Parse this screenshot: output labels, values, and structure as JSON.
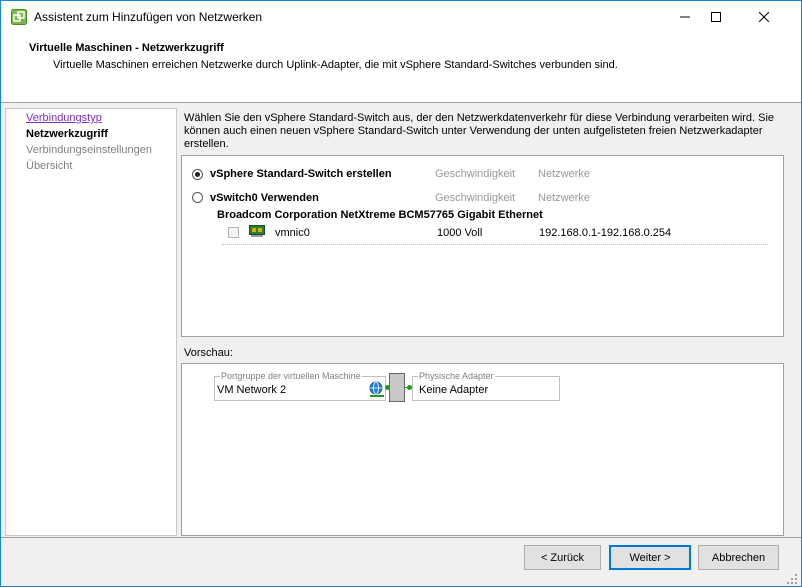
{
  "window": {
    "title": "Assistent zum Hinzufügen von Netzwerken",
    "accent": "#1883d7"
  },
  "header": {
    "title": "Virtuelle Maschinen - Netzwerkzugriff",
    "subtitle": "Virtuelle Maschinen erreichen Netzwerke durch Uplink-Adapter, die mit vSphere Standard-Switches verbunden sind."
  },
  "nav": {
    "items": [
      {
        "label": "Verbindungstyp",
        "state": "link"
      },
      {
        "label": "Netzwerkzugriff",
        "state": "active"
      },
      {
        "label": "Verbindungseinstellungen",
        "state": "disabled"
      },
      {
        "label": "Übersicht",
        "state": "disabled"
      }
    ]
  },
  "main": {
    "description": "Wählen Sie den vSphere Standard-Switch aus, der den Netzwerkdatenverkehr für diese Verbindung verarbeiten wird. Sie können auch einen neuen vSphere Standard-Switch unter Verwendung der unten aufgelisteten freien Netzwerkadapter erstellen.",
    "options": [
      {
        "label": "vSphere Standard-Switch erstellen",
        "selected": true,
        "speed_header": "Geschwindigkeit",
        "networks_header": "Netzwerke"
      },
      {
        "label": "vSwitch0 Verwenden",
        "selected": false,
        "speed_header": "Geschwindigkeit",
        "networks_header": "Netzwerke"
      }
    ],
    "adapter_group": "Broadcom Corporation NetXtreme BCM57765 Gigabit Ethernet",
    "adapters": [
      {
        "name": "vmnic0",
        "checked": false,
        "speed": "1000 Voll",
        "networks": "192.168.0.1-192.168.0.254"
      }
    ]
  },
  "preview": {
    "label": "Vorschau:",
    "portgroup_legend": "Portgruppe der virtuellen Maschine",
    "portgroup_value": "VM Network 2",
    "adapter_legend": "Physische Adapter",
    "adapter_value": "Keine Adapter"
  },
  "footer": {
    "back_label": "< Zurück",
    "next_label": "Weiter >",
    "cancel_label": "Abbrechen"
  }
}
